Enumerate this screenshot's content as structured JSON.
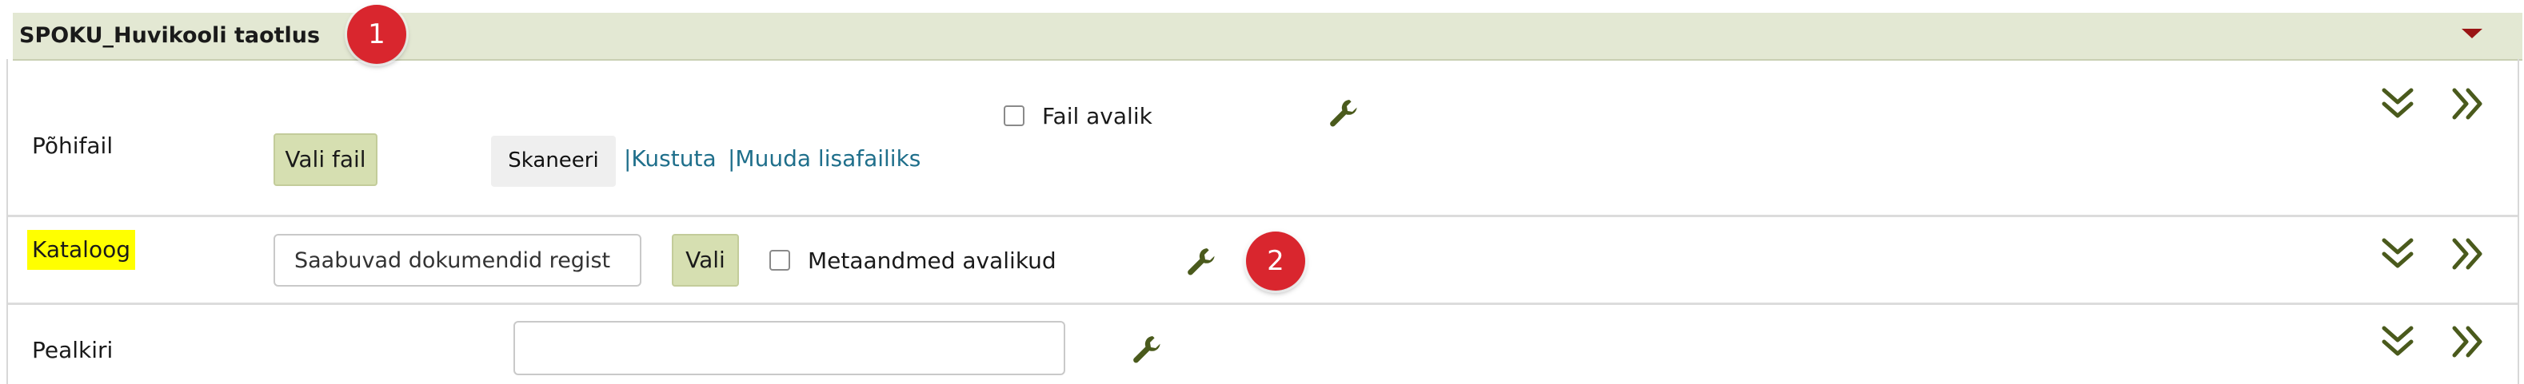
{
  "section": {
    "title": "SPOKU_Huvikooli taotlus",
    "collapse_icon": "caret-down-icon"
  },
  "callouts": [
    "1",
    "2"
  ],
  "colors": {
    "header_bg": "#e3e8d3",
    "accent_green": "#4a5a1c",
    "link": "#1f6f8b",
    "highlight": "#ffff00",
    "callout": "#d9262e",
    "button_green": "#d6dfb1"
  },
  "rows": {
    "main_file": {
      "label": "Põhifail",
      "choose_file_button": "Vali fail",
      "scan_button": "Skaneeri",
      "delete_link": "|Kustuta",
      "to_attachment_link": "|Muuda lisafailiks",
      "public_checkbox_label": "Fail avalik",
      "public_checked": false,
      "settings_icon": "wrench-icon",
      "expand_icon": "double-chevron-down-icon",
      "next_icon": "double-chevron-right-icon"
    },
    "catalog": {
      "label": "Kataloog",
      "input_value": "Saabuvad dokumendid regist",
      "choose_button": "Vali",
      "metadata_checkbox_label": "Metaandmed avalikud",
      "metadata_checked": false,
      "settings_icon": "wrench-icon",
      "expand_icon": "double-chevron-down-icon",
      "next_icon": "double-chevron-right-icon"
    },
    "title_row": {
      "label": "Pealkiri",
      "input_value": "",
      "settings_icon": "wrench-icon",
      "expand_icon": "double-chevron-down-icon",
      "next_icon": "double-chevron-right-icon"
    }
  }
}
